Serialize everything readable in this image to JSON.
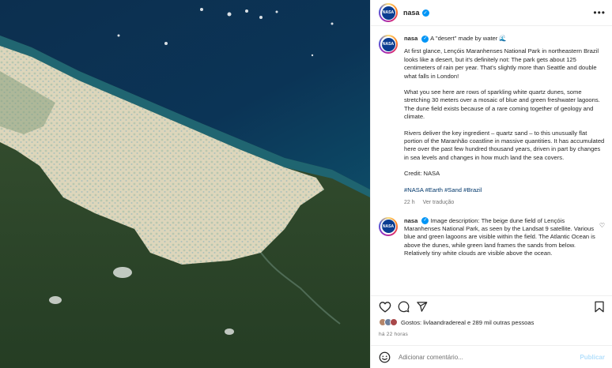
{
  "image": {
    "alt": "Satellite view of Lençóis Maranhenses dune field"
  },
  "post": {
    "username": "nasa",
    "avatar_text": "NASA",
    "more_icon": "more-horizontal-icon",
    "caption": {
      "username": "nasa",
      "title": "A \"desert\" made by water 🌊",
      "paragraphs": [
        "At first glance, Lençóis Maranhenses National Park in northeastern Brazil looks like a desert, but it's definitely not: The park gets about 125 centimeters of rain per year. That's slightly more than Seattle and double what falls in London!",
        "What you see here are rows of sparkling white quartz dunes, some stretching 30 meters over a mosaic of blue and green freshwater lagoons. The dune field exists because of a rare coming together of geology and climate.",
        "Rivers deliver the key ingredient – quartz sand – to this unusually flat portion of the Maranhão coastline in massive quantities. It has accumulated here over the past few hundred thousand years, driven in part by changes in sea levels and changes in how much land the sea covers.",
        "Credit: NASA"
      ],
      "hashtags": "#NASA #Earth #Sand #Brazil",
      "time": "22 h",
      "translate": "Ver tradução"
    },
    "reply": {
      "username": "nasa",
      "text": "Image description: The beige dune field of Lençóis Maranhenses National Park, as seen by the Landsat 9 satellite. Various blue and green lagoons are visible within the field. The Atlantic Ocean is above the dunes, while green land frames the sands from below. Relatively tiny white clouds are visible above the ocean."
    },
    "likes_text": "Gostos: livlaandradereal e 289 mil outras pessoas",
    "posted_time": "há 22 horas",
    "comment_placeholder": "Adicionar comentário...",
    "publish_label": "Publicar"
  },
  "colors": {
    "accent": "#0095f6",
    "verified": "#0095f6",
    "hashtag": "#00376b",
    "ocean": "#0a3a5c",
    "land": "#2e4a2a",
    "sand": "#e2dcc4"
  }
}
